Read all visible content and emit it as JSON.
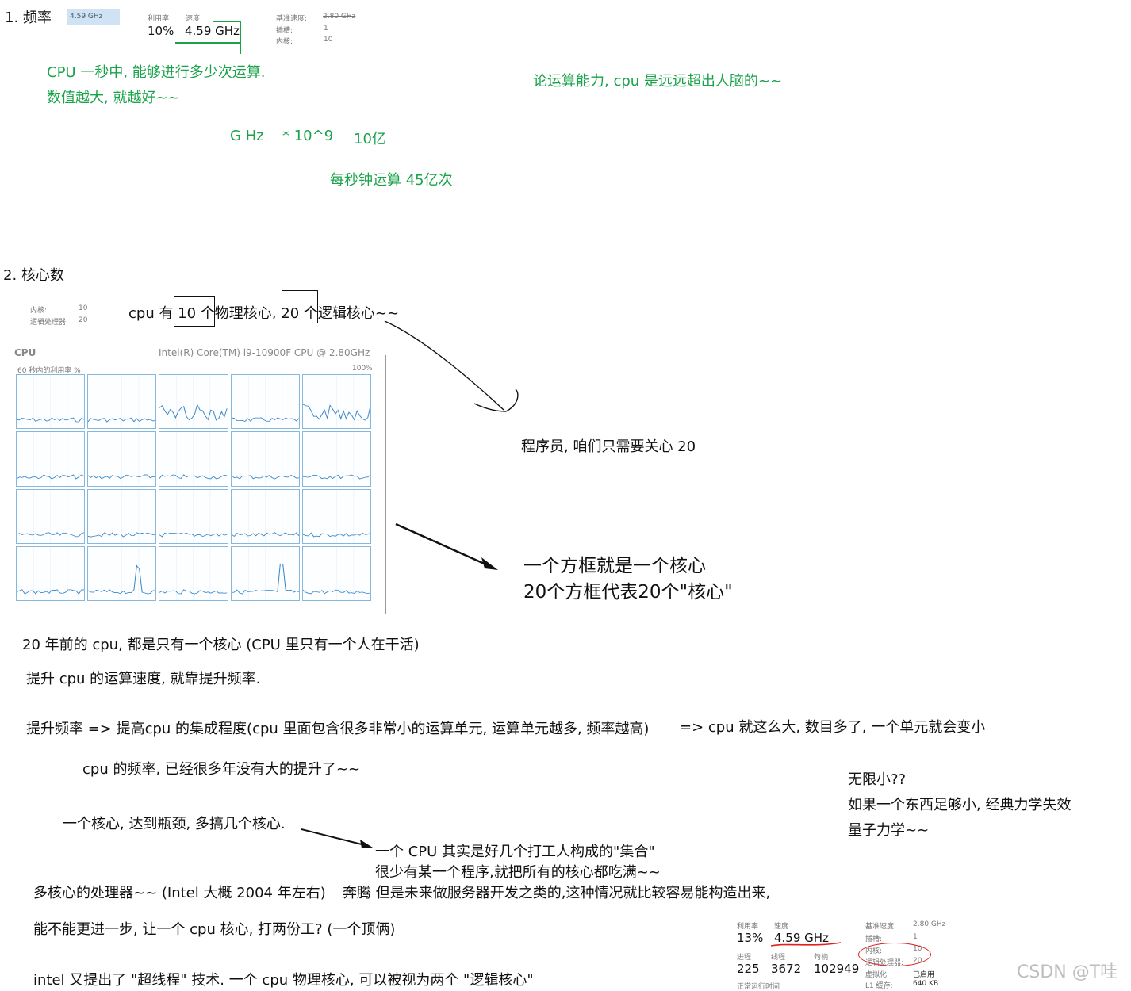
{
  "section1": {
    "heading": "1. 频率",
    "top_thumb_speed": "4.59 GHz",
    "util_label": "利用率",
    "speed_label": "速度",
    "util_value": "10%",
    "speed_value": "4.59 GHz",
    "base_speed_label": "基准速度:",
    "base_speed_value": "2.80 GHz",
    "sockets_label": "插槽:",
    "sockets_value": "1",
    "cores_label": "内核:",
    "cores_value": "10",
    "note1": "CPU 一秒中, 能够进行多少次运算.",
    "note2": "数值越大, 就越好~~",
    "note3": "论运算能力, cpu 是远远超出人脑的~~",
    "ghz": "G Hz",
    "pow": "* 10^9",
    "yi": "10亿",
    "per_second": "每秒钟运算 45亿次"
  },
  "section2": {
    "heading": "2. 核心数",
    "cores_label": "内核:",
    "cores_value": "10",
    "logical_label": "逻辑处理器:",
    "logical_value": "20",
    "cpu_sentence": "cpu 有 10 个物理核心, 20 个逻辑核心~~",
    "cpu_header_left": "CPU",
    "cpu_header_right": "Intel(R) Core(TM) i9-10900F CPU @ 2.80GHz",
    "cpu_util_label": "60 秒内的利用率 %",
    "cpu_util_max": "100%",
    "programmer_note": "程序员, 咱们只需要关心 20",
    "box_note1": "一个方框就是一个核心",
    "box_note2": "20个方框代表20个\"核心\""
  },
  "body_text": {
    "line1": "20 年前的 cpu, 都是只有一个核心 (CPU 里只有一个人在干活)",
    "line2": "提升 cpu 的运算速度, 就靠提升频率.",
    "line3a": "提升频率 => 提高cpu 的集成程度(cpu 里面包含很多非常小的运算单元, 运算单元越多, 频率越高)",
    "line3b": "=> cpu 就这么大, 数目多了, 一个单元就会变小",
    "line4": "cpu 的频率, 已经很多年没有大的提升了~~",
    "right1": "无限小??",
    "right2": "如果一个东西足够小, 经典力学失效",
    "right3": "量子力学~~",
    "line5": "一个核心, 达到瓶颈, 多搞几个核心.",
    "arrow_note1": "一个 CPU 其实是好几个打工人构成的\"集合\"",
    "arrow_note2": "很少有某一个程序,就把所有的核心都吃满~~",
    "line6a": "多核心的处理器~~ (Intel 大概 2004 年左右)",
    "line6b": "奔腾 但是未来做服务器开发之类的,这种情况就比较容易能构造出来,",
    "line7": "能不能更进一步, 让一个 cpu 核心, 打两份工? (一个顶俩)",
    "line8": "intel 又提出了 \"超线程\" 技术. 一个 cpu 物理核心, 可以被视为两个 \"逻辑核心\""
  },
  "bottom_panel": {
    "util_label": "利用率",
    "speed_label": "速度",
    "util_value": "13%",
    "speed_value": "4.59 GHz",
    "proc_label": "进程",
    "thread_label": "线程",
    "handle_label": "句柄",
    "proc_value": "225",
    "thread_value": "3672",
    "handle_value": "102949",
    "base_speed_label": "基准速度:",
    "base_speed_value": "2.80 GHz",
    "sockets_label": "插槽:",
    "sockets_value": "1",
    "cores_label": "内核:",
    "cores_value": "10",
    "logical_label": "逻辑处理器:",
    "logical_value": "20",
    "virt_label": "虚拟化:",
    "virt_value": "已启用",
    "l1_label": "L1 缓存:",
    "l1_value": "640 KB",
    "uptime_label": "正常运行时间"
  },
  "watermark": "CSDN @T哇",
  "colors": {
    "green": "#1aa34a",
    "cpu_line": "#3a86c8",
    "red_mark": "#e0221f"
  }
}
